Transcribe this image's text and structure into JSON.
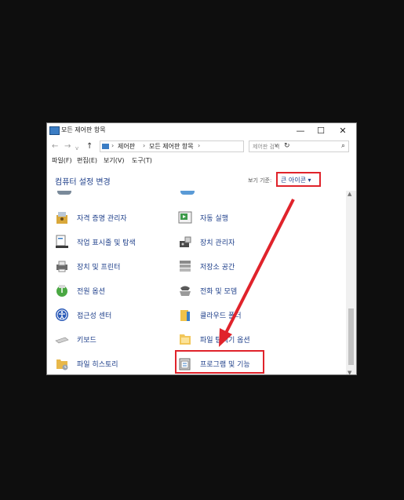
{
  "window": {
    "title": "모든 제어판 항목",
    "controls": {
      "minimize": "—",
      "maximize": "☐",
      "close": "✕"
    }
  },
  "address": {
    "back": "←",
    "forward": "→",
    "up": "↑",
    "crumbs": [
      "제어판",
      "모든 제어판 항목"
    ],
    "separator": "›",
    "refresh": "↻",
    "dropdown": "v"
  },
  "search": {
    "placeholder": "제어판 검색",
    "icon": "⌕"
  },
  "menu": [
    "파일(F)",
    "편집(E)",
    "보기(V)",
    "도구(T)"
  ],
  "header": {
    "title": "컴퓨터 설정 변경",
    "view_label": "보기 기준:",
    "view_value": "큰 아이콘 ▾"
  },
  "items_left": [
    {
      "label": "자격 증명 관리자",
      "icon": "credential-manager-icon"
    },
    {
      "label": "작업 표시줄 및 탐색",
      "icon": "taskbar-icon"
    },
    {
      "label": "장치 및 프린터",
      "icon": "devices-printers-icon"
    },
    {
      "label": "전원 옵션",
      "icon": "power-options-icon"
    },
    {
      "label": "접근성 센터",
      "icon": "ease-of-access-icon"
    },
    {
      "label": "키보드",
      "icon": "keyboard-icon"
    },
    {
      "label": "파일 히스토리",
      "icon": "file-history-icon"
    }
  ],
  "items_right": [
    {
      "label": "자동 실행",
      "icon": "autoplay-icon"
    },
    {
      "label": "장치 관리자",
      "icon": "device-manager-icon"
    },
    {
      "label": "저장소 공간",
      "icon": "storage-spaces-icon"
    },
    {
      "label": "전화 및 모뎀",
      "icon": "phone-modem-icon"
    },
    {
      "label": "클라우드 폴더",
      "icon": "work-folders-icon"
    },
    {
      "label": "파일 탐색기 옵션",
      "icon": "file-explorer-options-icon"
    },
    {
      "label": "프로그램 및 기능",
      "icon": "programs-features-icon"
    }
  ],
  "colors": {
    "highlight": "#e0232b",
    "link": "#1e3f8a"
  }
}
